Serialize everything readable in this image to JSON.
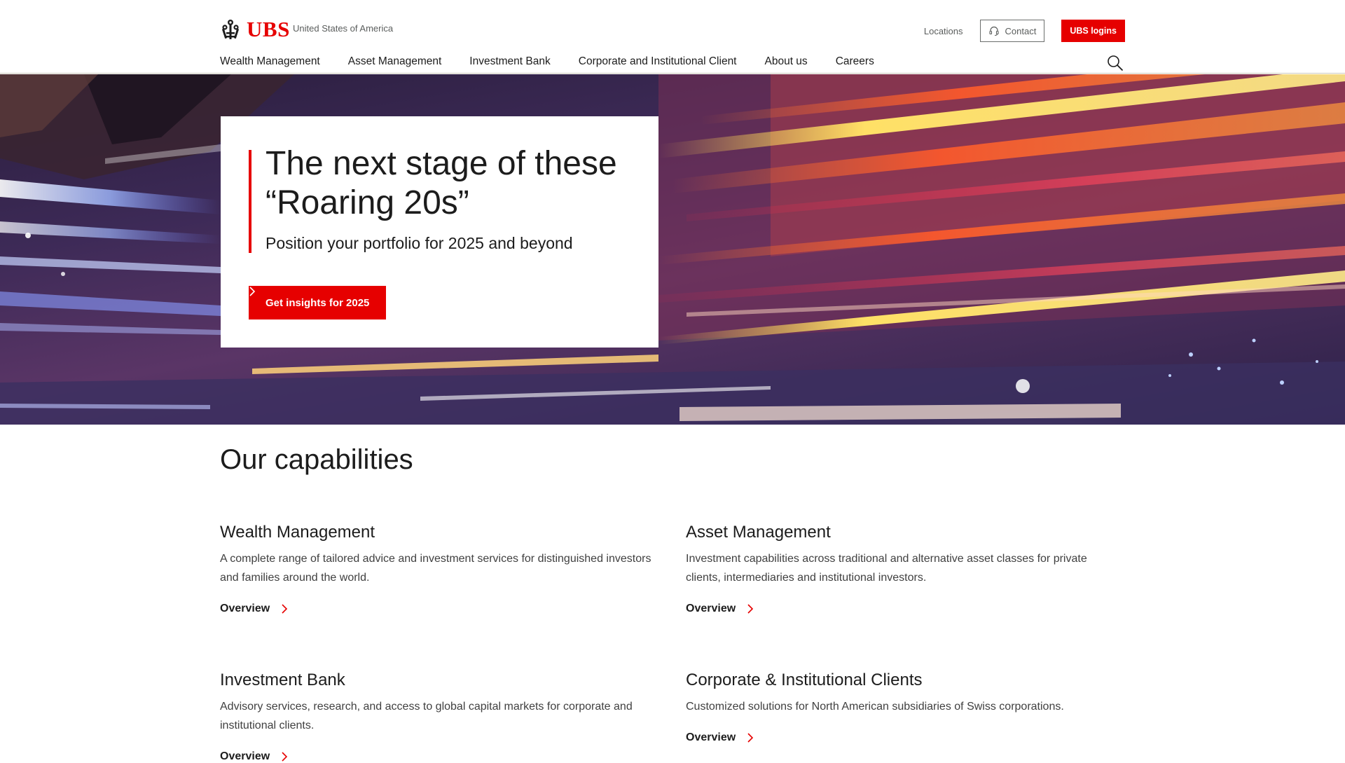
{
  "header": {
    "brand": "UBS",
    "region": "United States of America",
    "utility": {
      "locations": "Locations",
      "contact": "Contact",
      "logins": "UBS logins"
    },
    "nav": [
      {
        "label": "Wealth Management"
      },
      {
        "label": "Asset Management"
      },
      {
        "label": "Investment Bank"
      },
      {
        "label": "Corporate and Institutional Client"
      },
      {
        "label": "About us"
      },
      {
        "label": "Careers"
      }
    ]
  },
  "hero": {
    "title": "The next stage of these “Roaring 20s”",
    "subtitle": "Position your portfolio for 2025 and beyond",
    "cta": "Get insights for 2025"
  },
  "capabilities": {
    "title": "Our capabilities",
    "items": [
      {
        "title": "Wealth Management",
        "description": "A complete range of tailored advice and investment services for distinguished investors and families around the world.",
        "link": "Overview"
      },
      {
        "title": "Asset Management",
        "description": "Investment capabilities across traditional and alternative asset classes for private clients, intermediaries and institutional investors.",
        "link": "Overview"
      },
      {
        "title": "Investment Bank",
        "description": "Advisory services, research, and access to global capital markets for corporate and institutional clients.",
        "link": "Overview"
      },
      {
        "title": "Corporate & Institutional Clients",
        "description": "Customized solutions for North American subsidiaries of Swiss corporations.",
        "link": "Overview"
      }
    ]
  },
  "colors": {
    "brand_red": "#e60000",
    "text": "#1c1c1c",
    "muted": "#5a5d5c"
  },
  "icons": {
    "logo": "ubs-keys-logo-icon",
    "contact": "headset-icon",
    "search": "search-icon",
    "cta_arrow": "chevron-right-icon",
    "link_arrow": "chevron-right-icon"
  }
}
